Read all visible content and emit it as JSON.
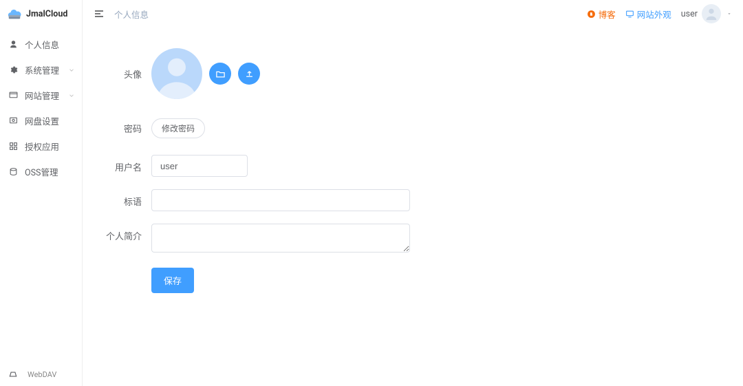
{
  "app_name": "JmalCloud",
  "sidebar": {
    "items": [
      {
        "label": "个人信息",
        "icon": "user-icon",
        "expandable": false
      },
      {
        "label": "系统管理",
        "icon": "gear-icon",
        "expandable": true
      },
      {
        "label": "网站管理",
        "icon": "site-icon",
        "expandable": true
      },
      {
        "label": "网盘设置",
        "icon": "disk-icon",
        "expandable": false
      },
      {
        "label": "授权应用",
        "icon": "apps-icon",
        "expandable": false
      },
      {
        "label": "OSS管理",
        "icon": "oss-icon",
        "expandable": false
      }
    ],
    "footer": {
      "label": "WebDAV",
      "icon": "drive-icon"
    }
  },
  "topbar": {
    "breadcrumb": "个人信息",
    "blog_label": "博客",
    "appearance_label": "网站外观",
    "username": "user"
  },
  "form": {
    "avatar_label": "头像",
    "password_label": "密码",
    "change_password_btn": "修改密码",
    "username_label": "用户名",
    "username_value": "user",
    "slogan_label": "标语",
    "slogan_value": "",
    "intro_label": "个人简介",
    "intro_value": "",
    "save_btn": "保存"
  }
}
